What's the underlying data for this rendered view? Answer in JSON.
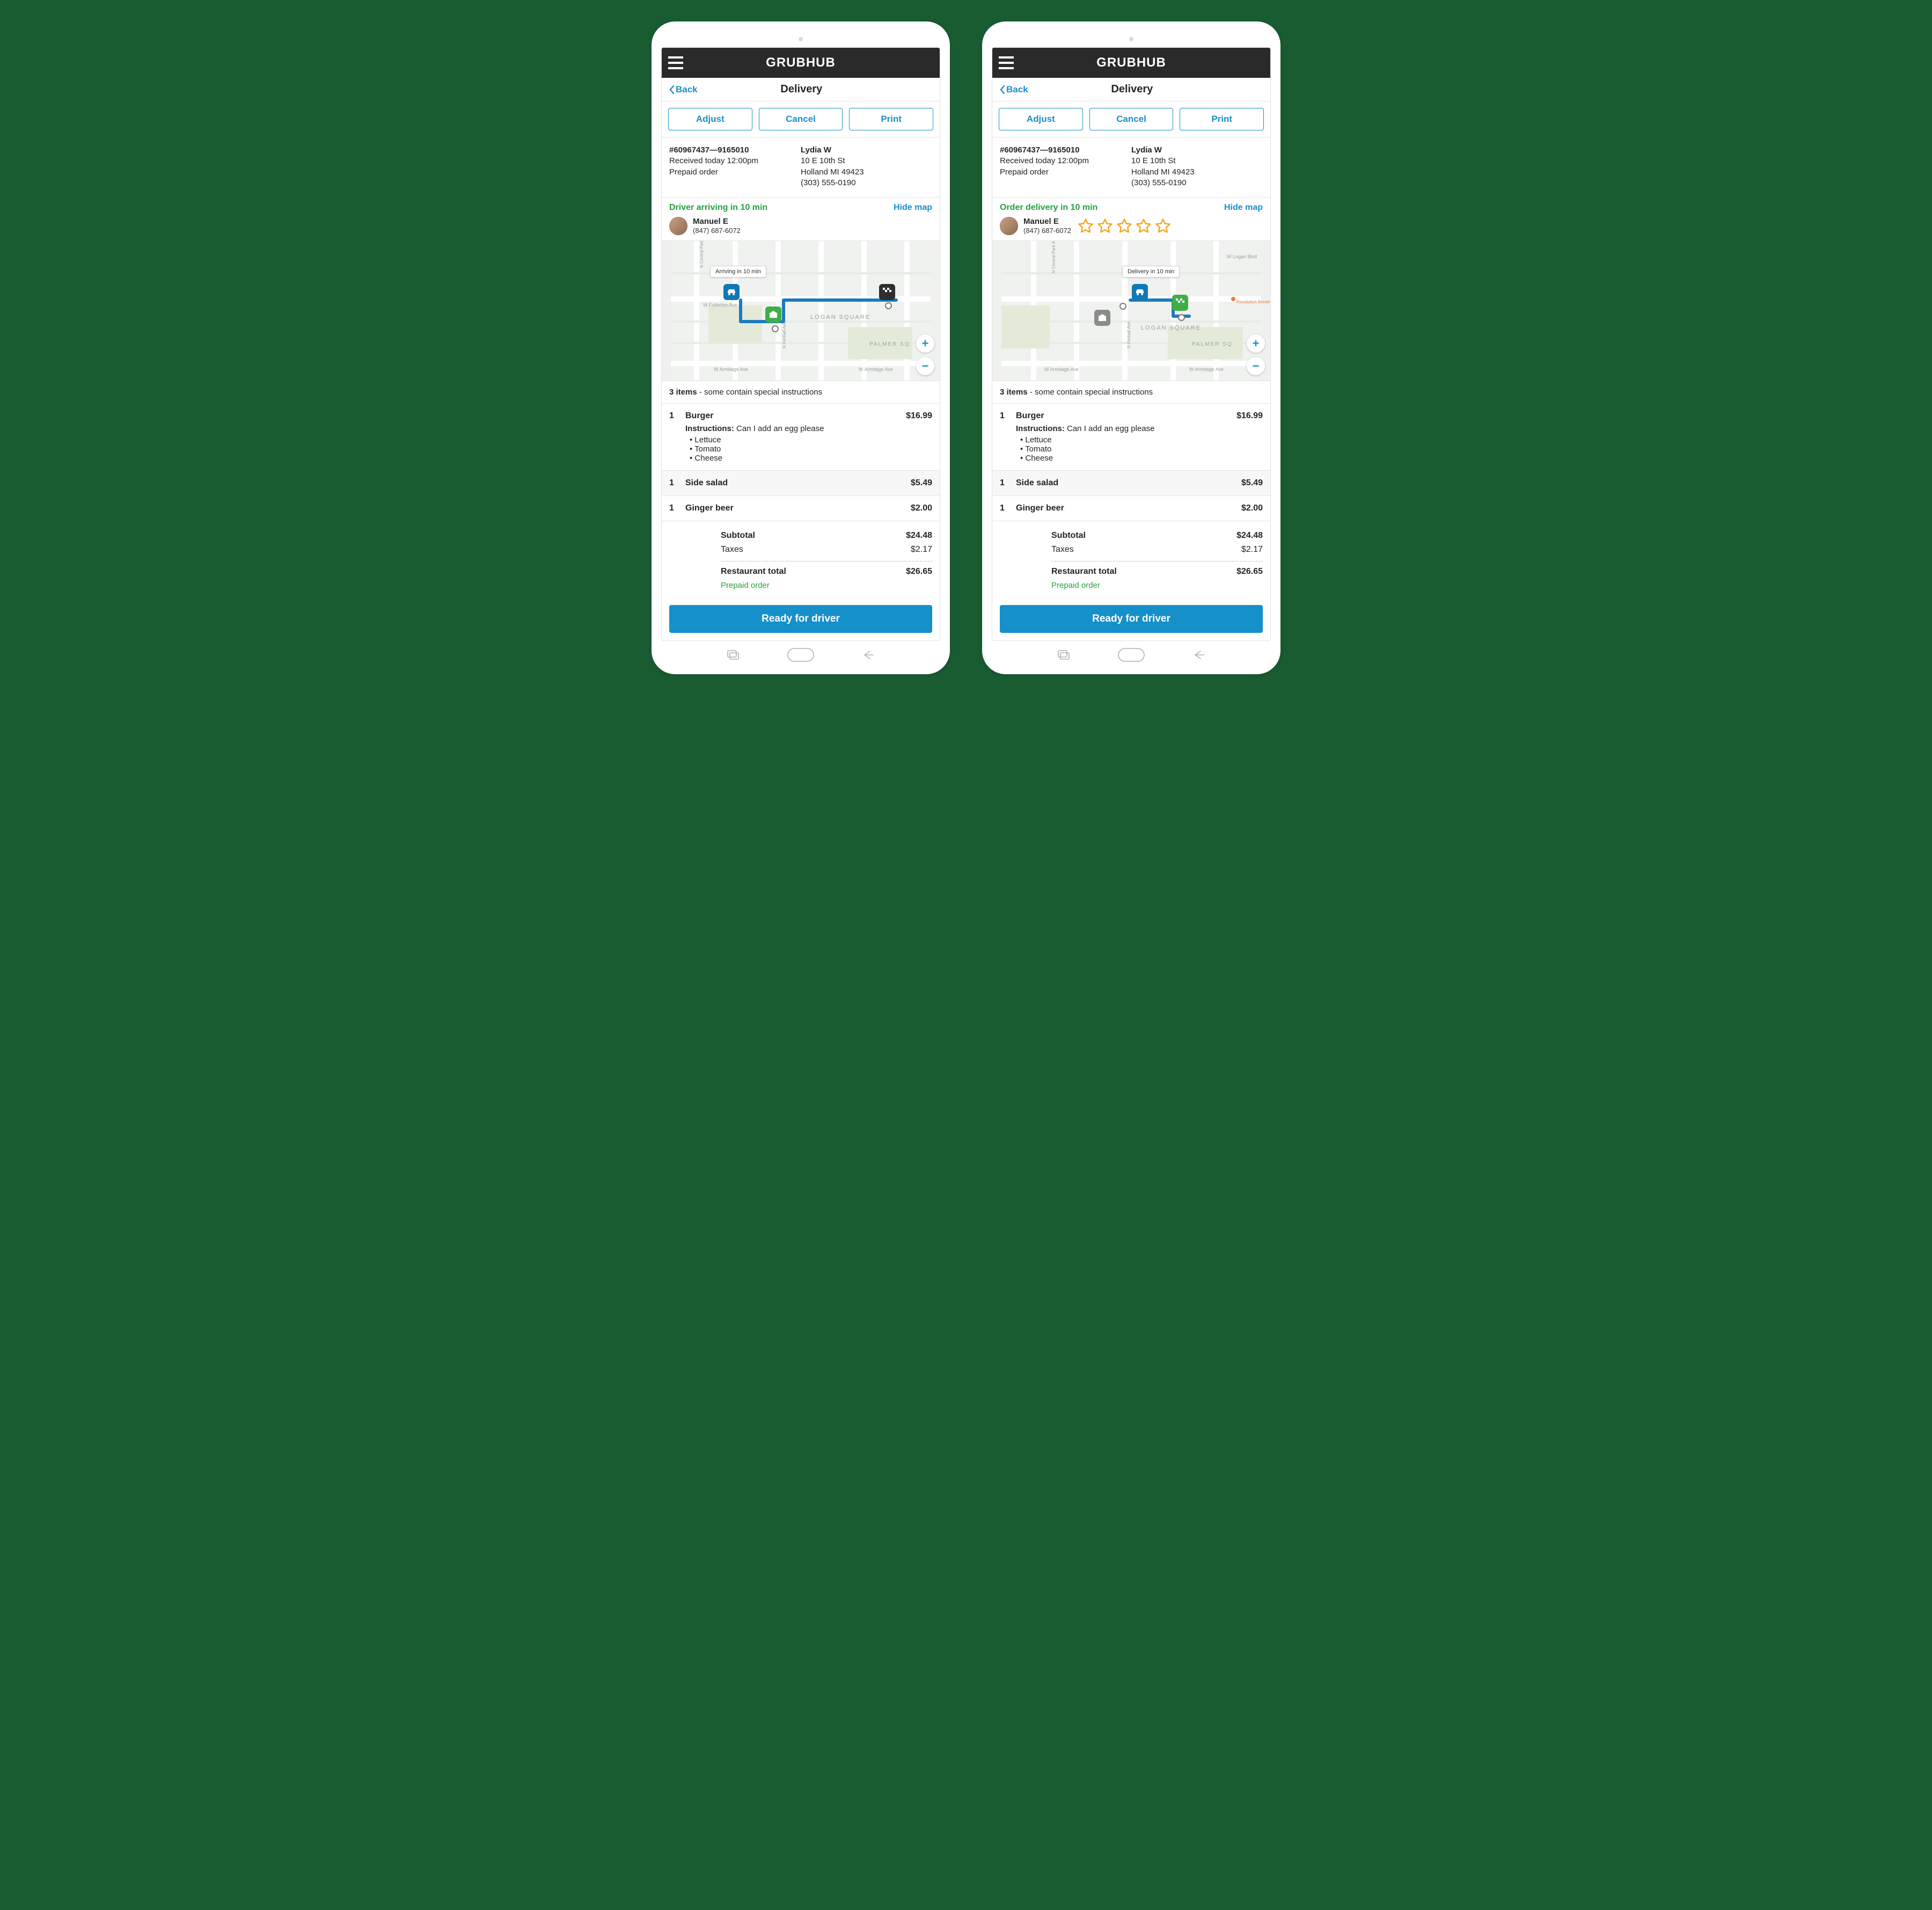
{
  "brand": "GRUBHUB",
  "back_label": "Back",
  "page_title": "Delivery",
  "actions": {
    "adjust": "Adjust",
    "cancel": "Cancel",
    "print": "Print"
  },
  "order": {
    "id": "#60967437—9165010",
    "received": "Received today 12:00pm",
    "payment": "Prepaid order",
    "customer_name": "Lydia W",
    "address_line1": "10 E 10th St",
    "address_line2": "Holland MI 49423",
    "phone": "(303) 555-0190"
  },
  "hide_map": "Hide map",
  "driver": {
    "name": "Manuel E",
    "phone": "(847) 687-6072"
  },
  "screens": [
    {
      "status_text": "Driver arriving in 10 min",
      "map_bubble": "Arriving in 10 min",
      "show_stars": false
    },
    {
      "status_text": "Order delivery in 10 min",
      "map_bubble": "Delivery in 10 min",
      "show_stars": true,
      "rating_out_of_5": 0
    }
  ],
  "items_header": {
    "count": "3 items",
    "note": " - some contain special instructions"
  },
  "items": [
    {
      "qty": "1",
      "name": "Burger",
      "price": "$16.99",
      "instructions_label": "Instructions:",
      "instructions": " Can I add an egg please",
      "options": [
        "Lettuce",
        "Tomato",
        "Cheese"
      ]
    },
    {
      "qty": "1",
      "name": "Side salad",
      "price": "$5.49"
    },
    {
      "qty": "1",
      "name": "Ginger beer",
      "price": "$2.00"
    }
  ],
  "totals": {
    "subtotal_label": "Subtotal",
    "subtotal": "$24.48",
    "taxes_label": "Taxes",
    "taxes": "$2.17",
    "restaurant_total_label": "Restaurant total",
    "restaurant_total": "$26.65",
    "prepaid": "Prepaid order"
  },
  "cta": "Ready for driver",
  "map_labels": {
    "fullerton": "W Fullerton Ave",
    "armitage": "W Armitage Ave",
    "logan": "LOGAN SQUARE",
    "palmer": "PALMER SQ",
    "kimball": "N Kimball Ave",
    "central": "N Central Park Ave",
    "wlogan": "W Logan Blvd",
    "revolution": "Revolution Brewing"
  }
}
